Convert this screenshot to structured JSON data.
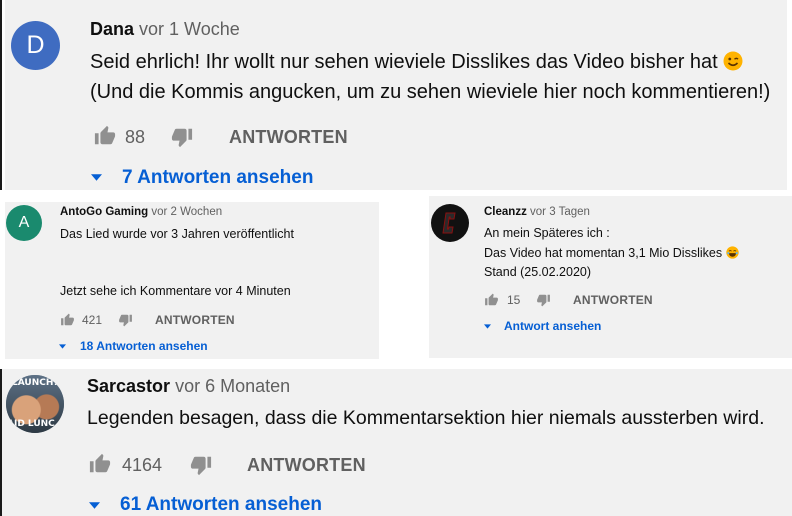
{
  "comments": [
    {
      "avatar_letter": "D",
      "avatar_color": "#3f6cc1",
      "author": "Dana",
      "time": "vor 1 Woche",
      "lines": [
        "Seid ehrlich! Ihr wollt nur sehen wieviele Disslikes das Video bisher hat",
        "(Und die Kommis angucken, um zu sehen wieviele hier noch kommentieren!)"
      ],
      "emoji": "wink-emoji",
      "likes": "88",
      "reply_label": "ANTWORTEN",
      "view_replies": "7 Antworten ansehen"
    },
    {
      "avatar_letter": "A",
      "avatar_color": "#1a8a6e",
      "author": "AntoGo Gaming",
      "time": "vor 2 Wochen",
      "lines": [
        "Das Lied wurde vor 3 Jahren veröffentlicht",
        "Jetzt sehe ich Kommentare vor 4 Minuten"
      ],
      "likes": "421",
      "reply_label": "ANTWORTEN",
      "view_replies": "18 Antworten ansehen"
    },
    {
      "avatar_letter": "C",
      "avatar_color": "#111111",
      "author": "Cleanzz",
      "time": "vor 3 Tagen",
      "lines": [
        "An mein Späteres ich :",
        "Das Video hat momentan 3,1 Mio Disslikes",
        "Stand (25.02.2020)"
      ],
      "emoji": "laughing-emoji",
      "likes": "15",
      "reply_label": "ANTWORTEN",
      "view_replies": "Antwort ansehen"
    },
    {
      "avatar_text_top": "LAUNCH?",
      "avatar_text_bottom": "AID LUNC",
      "author": "Sarcastor",
      "time": "vor 6 Monaten",
      "lines": [
        "Legenden besagen, dass die Kommentarsektion hier niemals aussterben wird."
      ],
      "likes": "4164",
      "reply_label": "ANTWORTEN",
      "view_replies": "61 Antworten ansehen"
    }
  ],
  "colors": {
    "panel_bg": "#f1f1f1",
    "link_blue": "#065fd4",
    "meta_gray": "#606060"
  }
}
